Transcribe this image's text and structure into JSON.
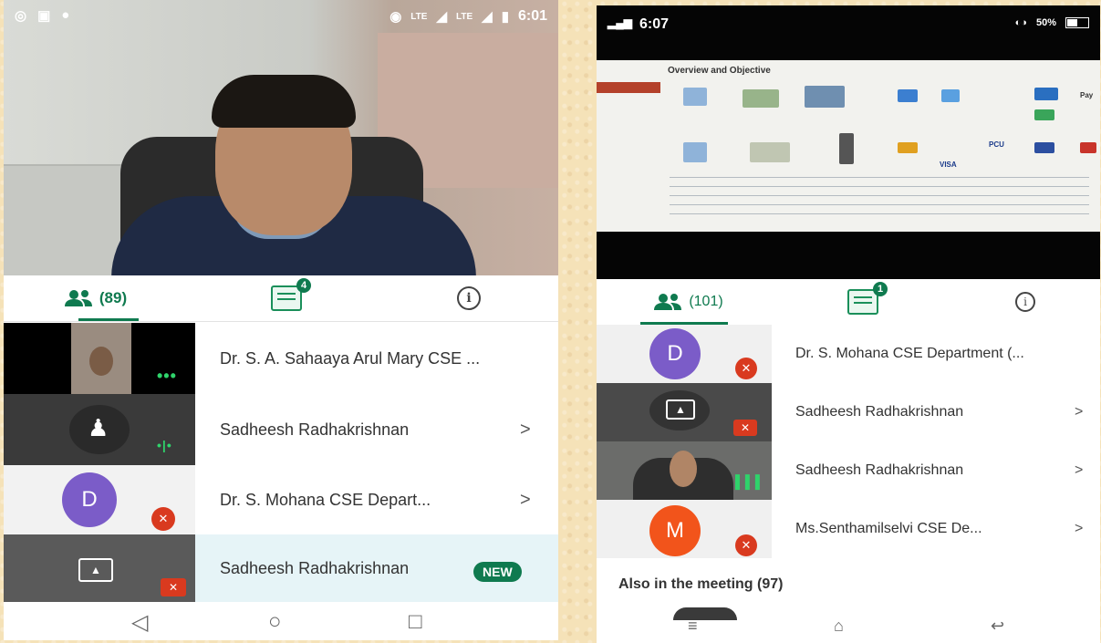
{
  "left_phone": {
    "status": {
      "time": "6:01",
      "signal_a": "LTE",
      "signal_b": "LTE"
    },
    "tabs": {
      "people_count": "(89)",
      "chat_badge": "4"
    },
    "participants": [
      {
        "name": "Dr. S. A. Sahaaya Arul Mary CSE ..."
      },
      {
        "name": "Sadheesh Radhakrishnan",
        "chevron": ">"
      },
      {
        "name": "Dr. S. Mohana CSE Depart...",
        "chevron": ">",
        "avatar_letter": "D"
      },
      {
        "name": "Sadheesh Radhakrishnan",
        "badge": "NEW"
      }
    ]
  },
  "right_phone": {
    "status": {
      "time": "6:07",
      "battery": "50%"
    },
    "slide": {
      "title": "Overview and Objective",
      "logos": [
        "VISA",
        "PCU",
        "Pay"
      ]
    },
    "tabs": {
      "people_count": "(101)",
      "chat_badge": "1"
    },
    "participants": [
      {
        "name": "Dr. S. Mohana CSE Department (...",
        "avatar_letter": "D"
      },
      {
        "name": "Sadheesh Radhakrishnan",
        "chevron": ">"
      },
      {
        "name": "Sadheesh Radhakrishnan",
        "chevron": ">"
      },
      {
        "name": "Ms.Senthamilselvi CSE De...",
        "chevron": ">",
        "avatar_letter": "M"
      }
    ],
    "also_in_meeting": "Also in the meeting (97)"
  },
  "colors": {
    "accent": "#0f7a4f",
    "mute": "#d93a1f",
    "avatar_purple": "#7b5cc8",
    "avatar_orange": "#f2541b"
  }
}
